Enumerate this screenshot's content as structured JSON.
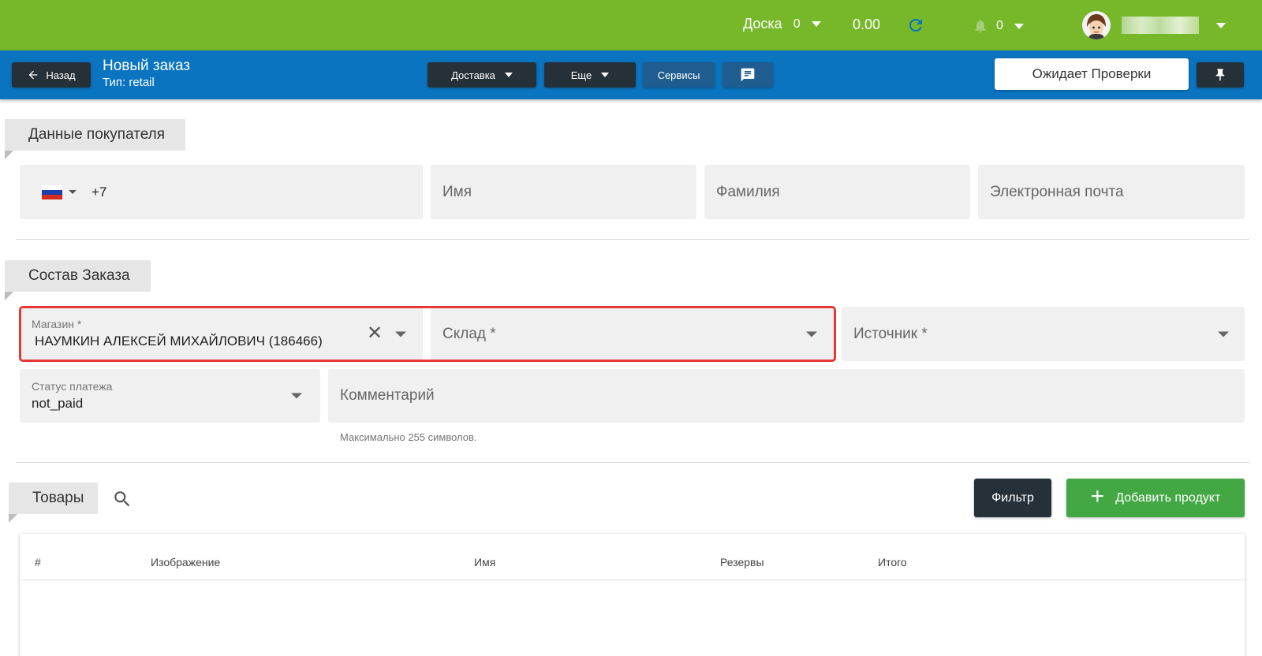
{
  "topbar": {
    "board_label": "Доска",
    "board_count": "0",
    "balance": "0.00",
    "notifications_count": "0",
    "colors": {
      "background": "#76b82a",
      "refresh": "#0a74c0"
    }
  },
  "header": {
    "back_label": "Назад",
    "title": "Новый заказ",
    "subtitle": "Тип: retail",
    "delivery_label": "Доставка",
    "more_label": "Еще",
    "services_label": "Сервисы",
    "status_label": "Ожидает Проверки",
    "colors": {
      "background": "#0a74c0",
      "button": "#253039"
    }
  },
  "customer": {
    "section_label": "Данные покупателя",
    "phone_code": "+7",
    "name_placeholder": "Имя",
    "surname_placeholder": "Фамилия",
    "email_placeholder": "Электронная почта"
  },
  "order": {
    "section_label": "Состав Заказа",
    "shop_label": "Магазин *",
    "shop_value": "НАУМКИН АЛЕКСЕЙ МИХАЙЛОВИЧ (186466)",
    "warehouse_placeholder": "Склад *",
    "source_placeholder": "Источник *",
    "payment_status_label": "Статус платежа",
    "payment_status_value": "not_paid",
    "comment_placeholder": "Комментарий",
    "comment_hint": "Максимально 255 символов.",
    "highlight_color": "#e53935"
  },
  "goods": {
    "section_label": "Товары",
    "filter_label": "Фильтр",
    "add_label": "Добавить продукт",
    "columns": [
      "#",
      "Изображение",
      "Имя",
      "Резервы",
      "Итого"
    ],
    "add_color": "#43a843"
  }
}
